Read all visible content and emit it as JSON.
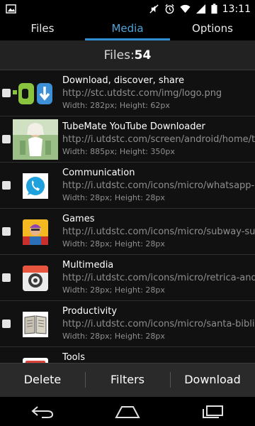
{
  "status_bar": {
    "time": "13:11",
    "icons": [
      "image-notification-icon",
      "mute-icon",
      "alarm-icon",
      "wifi-icon",
      "signal-icon",
      "battery-icon"
    ]
  },
  "tabs": [
    {
      "label": "Files",
      "active": false
    },
    {
      "label": "Media",
      "active": true
    },
    {
      "label": "Options",
      "active": false
    }
  ],
  "files_header": {
    "label": "Files:",
    "count": "54"
  },
  "items": [
    {
      "title": "Download, discover, share",
      "url": "http://stc.utdstc.com/img/logo.png",
      "dims": "Width: 282px; Height: 62px",
      "icon": "uptodown-logo-icon"
    },
    {
      "title": "TubeMate YouTube Downloader",
      "url": "http://i.utdstc.com/screen/android/home/tubemate",
      "dims": "Width: 885px; Height: 350px",
      "icon": "tubemate-screenshot-icon"
    },
    {
      "title": "Communication",
      "url": "http://i.utdstc.com/icons/micro/whatsapp-plus",
      "dims": "Width: 28px; Height: 28px",
      "icon": "whatsapp-icon"
    },
    {
      "title": "Games",
      "url": "http://i.utdstc.com/icons/micro/subway-surfers",
      "dims": "Width: 28px; Height: 28px",
      "icon": "subway-surfers-icon"
    },
    {
      "title": "Multimedia",
      "url": "http://i.utdstc.com/icons/micro/retrica-android",
      "dims": "Width: 28px; Height: 28px",
      "icon": "retrica-icon"
    },
    {
      "title": "Productivity",
      "url": "http://i.utdstc.com/icons/micro/santa-biblia-r",
      "dims": "Width: 28px; Height: 28px",
      "icon": "bible-book-icon"
    },
    {
      "title": "Tools",
      "url": "",
      "dims": "",
      "icon": "tools-icon"
    }
  ],
  "actions": {
    "delete": "Delete",
    "filters": "Filters",
    "download": "Download"
  },
  "nav": [
    "back-icon",
    "home-icon",
    "recents-icon"
  ],
  "colors": {
    "accent": "#2f8fd0",
    "background": "#111111",
    "action_bar": "#2a2a2a"
  }
}
